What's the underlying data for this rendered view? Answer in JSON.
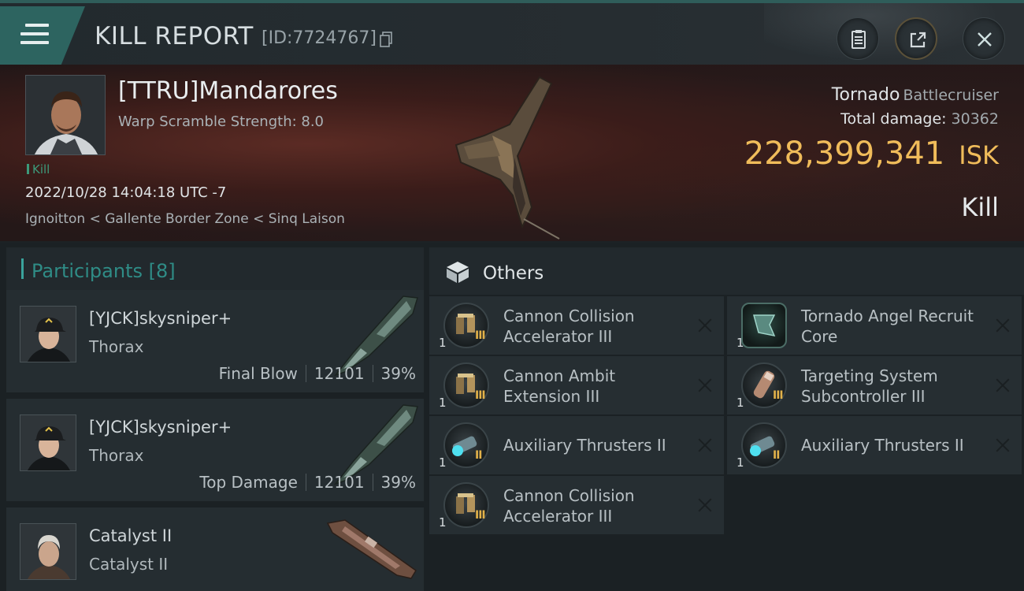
{
  "header": {
    "title": "KILL REPORT",
    "kill_id": "[ID:7724767]"
  },
  "victim": {
    "name": "[TTRU]Mandarores",
    "subtitle": "Warp Scramble Strength: 8.0",
    "tag": "Kill",
    "datetime": "2022/10/28 14:04:18 UTC -7",
    "location": "Ignoitton < Gallente Border Zone < Sinq Laison",
    "ship_name": "Tornado",
    "ship_class": "Battlecruiser",
    "damage_label": "Total damage:",
    "damage_value": "30362",
    "isk_value": "228,399,341",
    "isk_currency": "ISK",
    "status": "Kill"
  },
  "participants": {
    "heading": "Participants [8]",
    "rows": [
      {
        "name": "[YJCK]skysniper+",
        "ship": "Thorax",
        "label": "Final Blow",
        "damage": "12101",
        "percent": "39%"
      },
      {
        "name": "[YJCK]skysniper+",
        "ship": "Thorax",
        "label": "Top Damage",
        "damage": "12101",
        "percent": "39%"
      },
      {
        "name": "Catalyst II",
        "ship": "Catalyst II",
        "label": "",
        "damage": "",
        "percent": ""
      }
    ]
  },
  "others": {
    "heading": "Others",
    "items": [
      {
        "name": "Cannon Collision Accelerator III",
        "qty": "1",
        "tier": "III",
        "icon": "gun-module-icon"
      },
      {
        "name": "Tornado Angel Recruit Core",
        "qty": "1",
        "tier": "",
        "icon": "ship-core-icon"
      },
      {
        "name": "Cannon Ambit Extension III",
        "qty": "1",
        "tier": "III",
        "icon": "gun-module-icon"
      },
      {
        "name": "Targeting System Subcontroller III",
        "qty": "1",
        "tier": "III",
        "icon": "targeting-rig-icon"
      },
      {
        "name": "Auxiliary Thrusters II",
        "qty": "1",
        "tier": "II",
        "icon": "thruster-icon"
      },
      {
        "name": "Auxiliary Thrusters II",
        "qty": "1",
        "tier": "II",
        "icon": "thruster-icon"
      },
      {
        "name": "Cannon Collision Accelerator III",
        "qty": "1",
        "tier": "III",
        "icon": "gun-module-icon"
      }
    ]
  },
  "colors": {
    "accent_teal": "#2f8c86",
    "isk_gold": "#f0bc5a",
    "kill_green": "#3c9a7a"
  }
}
